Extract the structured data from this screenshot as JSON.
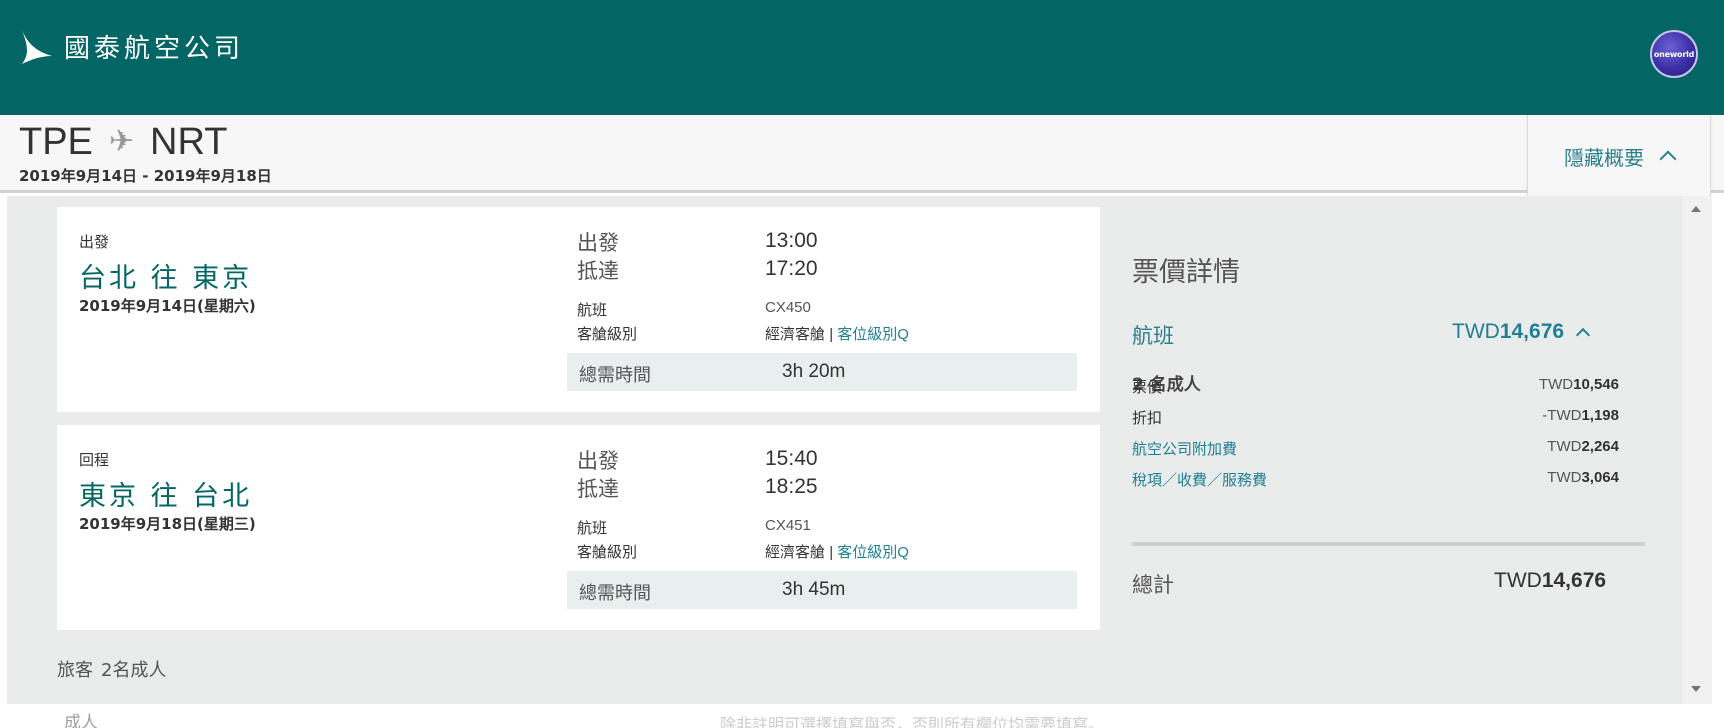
{
  "header": {
    "logo_text": "國泰航空公司",
    "oneworld_label": "oneworld",
    "brand_color": "#036664"
  },
  "summary": {
    "origin": "TPE",
    "destination": "NRT",
    "dates": "2019年9月14日 - 2019年9月18日",
    "hide_label": "隱藏概要"
  },
  "legs": [
    {
      "type": "出發",
      "title": "台北 往 東京",
      "date": "2019年9月14日(星期六)",
      "depart_label": "出發",
      "depart_time": "13:00",
      "arrive_label": "抵達",
      "arrive_time": "17:20",
      "flight_label": "航班",
      "flight_no": "CX450",
      "cabin_label": "客艙級別",
      "cabin": "經濟客艙",
      "separator": "|",
      "class_link": "客位級別Q",
      "duration_label": "總需時間",
      "duration": "3h 20m"
    },
    {
      "type": "回程",
      "title": "東京 往 台北",
      "date": "2019年9月18日(星期三)",
      "depart_label": "出發",
      "depart_time": "15:40",
      "arrive_label": "抵達",
      "arrive_time": "18:25",
      "flight_label": "航班",
      "flight_no": "CX451",
      "cabin_label": "客艙級別",
      "cabin": "經濟客艙",
      "separator": "|",
      "class_link": "客位級別Q",
      "duration_label": "總需時間",
      "duration": "3h 45m"
    }
  ],
  "passengers": {
    "label": "旅客",
    "value": "2名成人"
  },
  "fare": {
    "title": "票價詳情",
    "flight_label": "航班",
    "flight_currency": "TWD",
    "flight_amount": "14,676",
    "pax": "2 名成人",
    "rows": [
      {
        "label": "票價",
        "prefix": "TWD",
        "amount": "10,546"
      },
      {
        "label": "折扣",
        "prefix": "-TWD",
        "amount": "1,198"
      },
      {
        "label": "航空公司附加費",
        "prefix": "TWD",
        "amount": "2,264"
      },
      {
        "label": "稅項／收費／服務費",
        "prefix": "TWD",
        "amount": "3,064"
      }
    ],
    "total_label": "總計",
    "total_currency": "TWD",
    "total_amount": "14,676"
  },
  "footer": {
    "adult_label": "成人",
    "note": "除非註明可選擇填寫與否，否則所有欄位均需要填寫。"
  }
}
